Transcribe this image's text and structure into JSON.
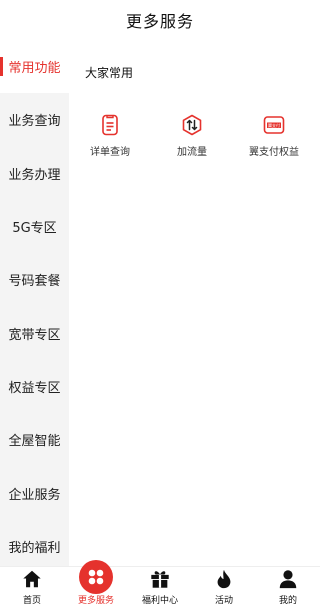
{
  "header": {
    "title": "更多服务"
  },
  "sidebar": {
    "items": [
      {
        "label": "常用功能",
        "active": true
      },
      {
        "label": "业务查询"
      },
      {
        "label": "业务办理"
      },
      {
        "label": "5G专区"
      },
      {
        "label": "号码套餐"
      },
      {
        "label": "宽带专区"
      },
      {
        "label": "权益专区"
      },
      {
        "label": "全屋智能"
      },
      {
        "label": "企业服务"
      },
      {
        "label": "我的福利"
      }
    ]
  },
  "main": {
    "section_title": "大家常用",
    "items": [
      {
        "label": "详单查询",
        "icon": "bill-detail-icon"
      },
      {
        "label": "加流量",
        "icon": "data-traffic-icon"
      },
      {
        "label": "翼支付权益",
        "icon": "bestpay-icon",
        "icon_text": "翼支付"
      }
    ]
  },
  "tabbar": {
    "items": [
      {
        "label": "首页",
        "icon": "home-icon"
      },
      {
        "label": "更多服务",
        "icon": "more-services-icon",
        "active": true
      },
      {
        "label": "福利中心",
        "icon": "gift-icon"
      },
      {
        "label": "活动",
        "icon": "flame-icon"
      },
      {
        "label": "我的",
        "icon": "user-icon"
      }
    ]
  },
  "colors": {
    "accent": "#e5322d",
    "sidebar_bg": "#f4f4f4"
  }
}
